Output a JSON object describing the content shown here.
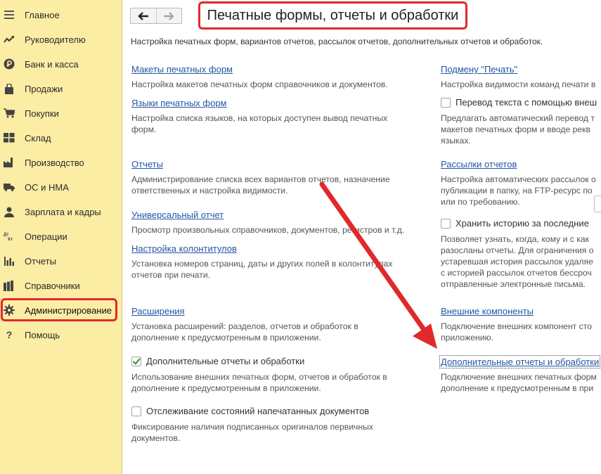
{
  "sidebar": {
    "items": [
      {
        "label": "Главное",
        "icon": "menu-icon"
      },
      {
        "label": "Руководителю",
        "icon": "trend-icon"
      },
      {
        "label": "Банк и касса",
        "icon": "ruble-icon"
      },
      {
        "label": "Продажи",
        "icon": "bag-icon"
      },
      {
        "label": "Покупки",
        "icon": "cart-icon"
      },
      {
        "label": "Склад",
        "icon": "warehouse-icon"
      },
      {
        "label": "Производство",
        "icon": "factory-icon"
      },
      {
        "label": "ОС и НМА",
        "icon": "truck-icon"
      },
      {
        "label": "Зарплата и кадры",
        "icon": "person-icon"
      },
      {
        "label": "Операции",
        "icon": "dt-kt-icon"
      },
      {
        "label": "Отчеты",
        "icon": "bar-chart-icon"
      },
      {
        "label": "Справочники",
        "icon": "books-icon"
      },
      {
        "label": "Администрирование",
        "icon": "gear-icon"
      },
      {
        "label": "Помощь",
        "icon": "question-icon"
      }
    ],
    "selected_index": 12,
    "icon_text_dtkt": {
      "dt": "Дт",
      "kt": "Кт"
    },
    "help_glyph": "?"
  },
  "header": {
    "back_glyph": "🡐",
    "forward_glyph": "🡒",
    "title": "Печатные формы, отчеты и обработки",
    "subtitle": "Настройка печатных форм, вариантов отчетов, рассылок отчетов, дополнительных отчетов и обработок."
  },
  "left": {
    "makety": {
      "link": "Макеты печатных форм",
      "desc": "Настройка макетов печатных форм справочников и документов."
    },
    "yazyki": {
      "link": "Языки печатных форм",
      "desc1": "Настройка списка языков, на которых доступен вывод печатных",
      "desc2": "форм."
    },
    "otchety": {
      "link": "Отчеты",
      "desc1": "Администрирование списка всех вариантов отчетов, назначение",
      "desc2": "ответственных и настройка видимости."
    },
    "universal": {
      "link": "Универсальный отчет",
      "desc": "Просмотр произвольных справочников, документов, регистров и т.д."
    },
    "kolontituly": {
      "link": "Настройка колонтитулов",
      "desc1": "Установка номеров страниц, даты и других полей в колонтитулах",
      "desc2": "отчетов при печати."
    },
    "rasshireniya": {
      "link": "Расширения",
      "desc1": "Установка расширений: разделов, отчетов и обработок в",
      "desc2": "дополнение к предусмотренным в приложении."
    },
    "dop_otchety": {
      "label": "Дополнительные отчеты и обработки",
      "checked": true,
      "desc1": "Использование внешних печатных форм, отчетов и обработок в",
      "desc2": "дополнение к предусмотренным в приложении."
    },
    "otslezhivanie": {
      "label": "Отслеживание состояний напечатанных документов",
      "checked": false,
      "desc1": "Фиксирование наличия подписанных оригиналов первичных",
      "desc2": "документов."
    }
  },
  "right": {
    "podmenu": {
      "link": "Подмену \"Печать\"",
      "desc": "Настройка видимости команд печати в"
    },
    "perevod": {
      "label": "Перевод текста с помощью внеш",
      "checked": false,
      "desc1": "Предлагать автоматический перевод т",
      "desc2": "макетов печатных форм и вводе рекв",
      "desc3": "языках."
    },
    "rassylki": {
      "link": "Рассылки отчетов",
      "desc1": "Настройка автоматических рассылок о",
      "desc2": "публикации в папку, на FTP-ресурс по",
      "desc3": "или по требованию."
    },
    "istoriya": {
      "label": "Хранить историю за последние",
      "checked": false,
      "desc1": "Позволяет узнать, когда, кому и с как",
      "desc2": "разосланы отчеты. Для ограничения о",
      "desc3": "устаревшая история рассылок удаляе",
      "desc4": "с историей рассылок отчетов бессроч",
      "desc5": "отправленные электронные письма."
    },
    "vneshnie": {
      "link": "Внешние компоненты",
      "desc1": "Подключение внешних компонент сто",
      "desc2": "приложению."
    },
    "dop_otchety": {
      "link": "Дополнительные отчеты и обработки",
      "desc1": "Подключение внешних печатных форм",
      "desc2": "дополнение к предусмотренным в при"
    }
  },
  "colors": {
    "sidebar_bg": "#fbeda4",
    "highlight_red": "#e0292b",
    "link_blue": "#2357a3",
    "check_green": "#3a9a2f"
  }
}
